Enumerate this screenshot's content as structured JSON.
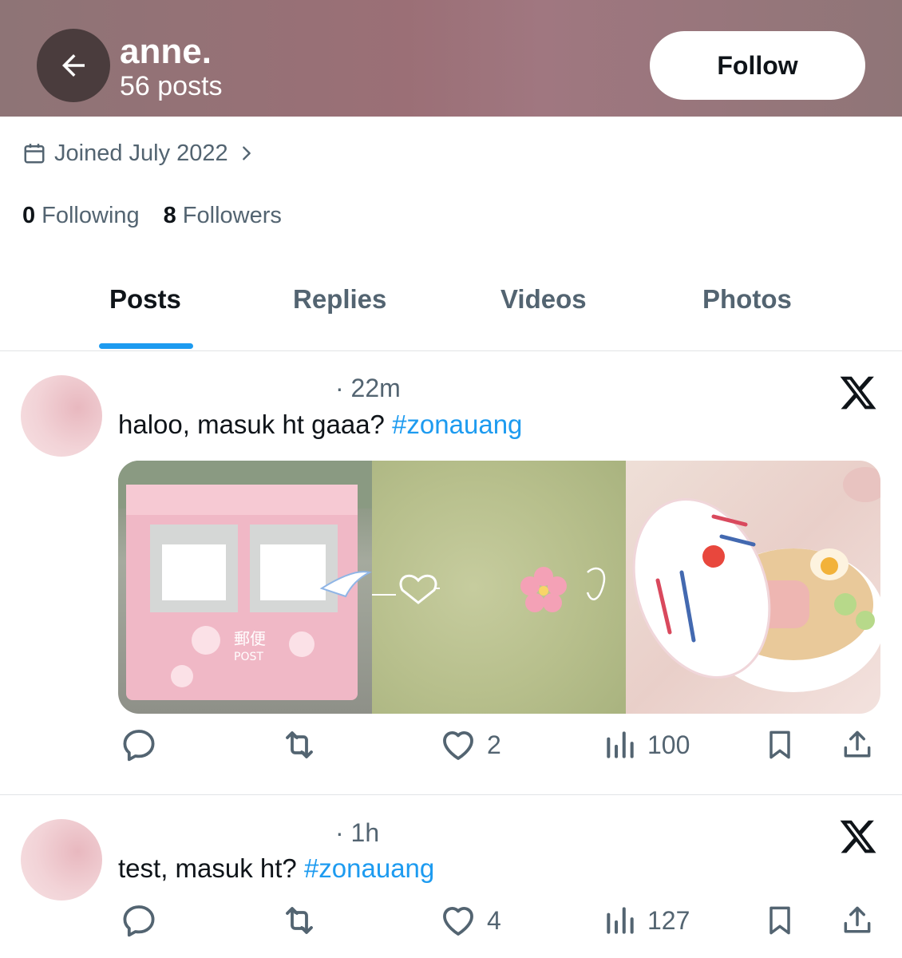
{
  "header": {
    "name": "anne.",
    "post_count": "56 posts",
    "follow_label": "Follow"
  },
  "profile": {
    "joined": "Joined July 2022",
    "following_count": "0",
    "following_label": "Following",
    "followers_count": "8",
    "followers_label": "Followers"
  },
  "tabs": [
    {
      "label": "Posts",
      "active": true
    },
    {
      "label": "Replies",
      "active": false
    },
    {
      "label": "Videos",
      "active": false
    },
    {
      "label": "Photos",
      "active": false
    }
  ],
  "posts": [
    {
      "time": "· 22m",
      "text": "haloo, masuk ht gaaa? ",
      "hashtag": "#zonauang",
      "likes": "2",
      "views": "100",
      "media_labels": {
        "post_label": "POST",
        "kanji": "郵便"
      }
    },
    {
      "time": "· 1h",
      "text": "test, masuk ht? ",
      "hashtag": "#zonauang",
      "likes": "4",
      "views": "127"
    }
  ],
  "colors": {
    "accent": "#1d9bf0",
    "secondary_text": "#536471",
    "header_bg": "#9b6f76"
  },
  "icons": {
    "back": "arrow-left-icon",
    "calendar": "calendar-icon",
    "reply": "reply-icon",
    "repost": "repost-icon",
    "like": "heart-icon",
    "views": "views-icon",
    "bookmark": "bookmark-icon",
    "share": "share-icon",
    "brand": "x-logo-icon"
  }
}
